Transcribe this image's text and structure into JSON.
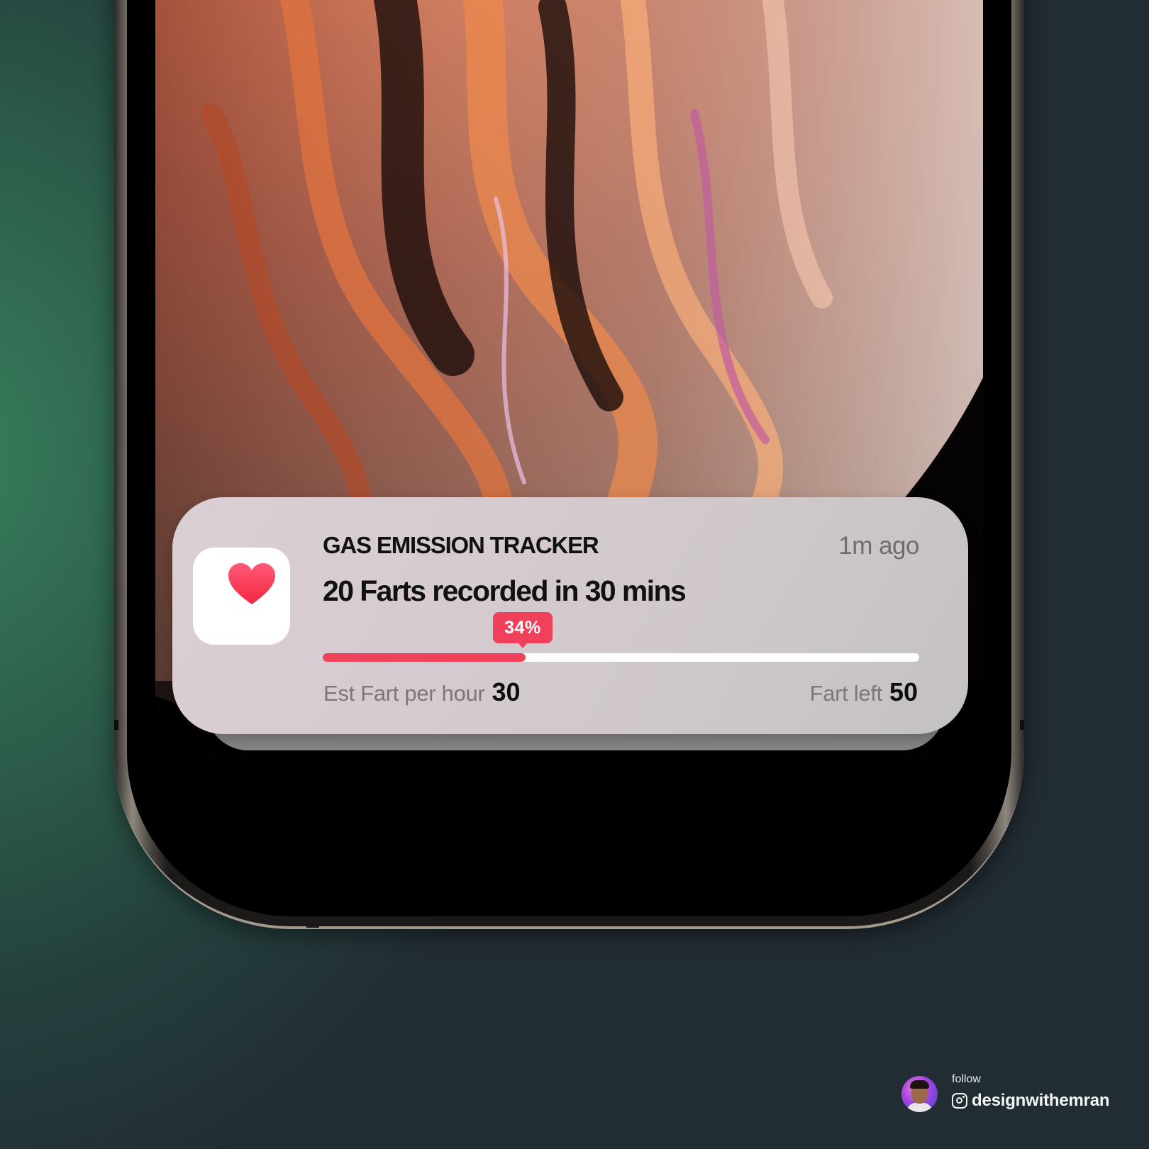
{
  "notification": {
    "app_name": "GAS EMISSION TRACKER",
    "timestamp": "1m ago",
    "title": "20 Farts recorded in 30 mins",
    "progress": {
      "percent": 34,
      "label": "34%"
    },
    "stats": {
      "left_label": "Est Fart per hour",
      "left_value": "30",
      "right_label": "Fart left",
      "right_value": "50"
    },
    "icon": "heart-icon"
  },
  "footer": {
    "follow_label": "follow",
    "handle": "designwithemran",
    "icon": "instagram-icon"
  },
  "colors": {
    "accent": "#f0405a",
    "card_background": "#d6cbd0",
    "page_background": "#24403d"
  }
}
